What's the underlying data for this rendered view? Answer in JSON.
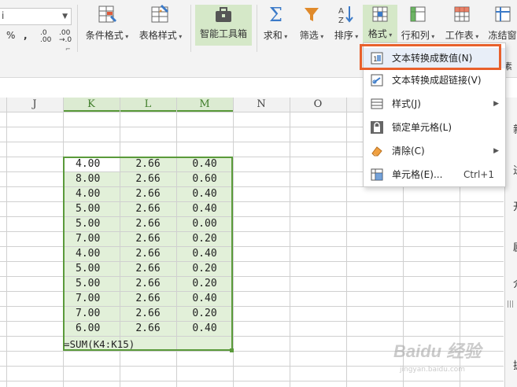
{
  "ribbon": {
    "font_name": "i",
    "number_format": {
      "percent": "%",
      "comma": ",",
      "inc_decimal_top": ".0",
      "inc_decimal_bottom": ".00",
      "dec_decimal_top": ".00",
      "dec_decimal_bottom": "→.0"
    },
    "buttons": [
      {
        "id": "conditional-format",
        "label": "条件格式"
      },
      {
        "id": "table-style",
        "label": "表格样式"
      },
      {
        "id": "smart-toolbox",
        "label": "智能工具箱"
      },
      {
        "id": "sum",
        "label": "求和"
      },
      {
        "id": "filter",
        "label": "筛选"
      },
      {
        "id": "sort",
        "label": "排序"
      },
      {
        "id": "format",
        "label": "格式"
      },
      {
        "id": "rows-cols",
        "label": "行和列"
      },
      {
        "id": "worksheet",
        "label": "工作表"
      },
      {
        "id": "freeze",
        "label": "冻结窗"
      }
    ]
  },
  "format_menu": {
    "items": [
      {
        "label": "文本转换成数值(N)",
        "icon": "convert-number-icon"
      },
      {
        "label": "文本转换成超链接(V)",
        "icon": "hyperlink-icon"
      },
      {
        "label": "样式(J)",
        "icon": "style-icon",
        "submenu": true
      },
      {
        "label": "锁定单元格(L)",
        "icon": "lock-icon"
      },
      {
        "label": "清除(C)",
        "icon": "eraser-icon",
        "submenu": true
      },
      {
        "label": "单元格(E)...",
        "shortcut": "Ctrl+1",
        "icon": "cell-format-icon"
      }
    ]
  },
  "sheet": {
    "columns": [
      "J",
      "K",
      "L",
      "M",
      "N",
      "O"
    ],
    "selected_columns": [
      "K",
      "L",
      "M"
    ],
    "data": [
      [
        "4.00",
        "2.66",
        "0.40"
      ],
      [
        "8.00",
        "2.66",
        "0.60"
      ],
      [
        "4.00",
        "2.66",
        "0.40"
      ],
      [
        "5.00",
        "2.66",
        "0.40"
      ],
      [
        "5.00",
        "2.66",
        "0.00"
      ],
      [
        "7.00",
        "2.66",
        "0.20"
      ],
      [
        "4.00",
        "2.66",
        "0.40"
      ],
      [
        "5.00",
        "2.66",
        "0.20"
      ],
      [
        "5.00",
        "2.66",
        "0.20"
      ],
      [
        "7.00",
        "2.66",
        "0.40"
      ],
      [
        "7.00",
        "2.66",
        "0.20"
      ],
      [
        "6.00",
        "2.66",
        "0.40"
      ]
    ],
    "formula": "=SUM(K4:K15)"
  },
  "side_pane": {
    "glyphs": [
      "新",
      "进",
      "开",
      "剧",
      "介",
      "抓"
    ],
    "partial_label": "素"
  },
  "colors": {
    "selection_fill": "#e2f0d9",
    "selection_border": "#5a9a3a",
    "highlight": "#e8602c",
    "header_selected": "#dcebd2"
  },
  "watermark": "Baidu 经验"
}
